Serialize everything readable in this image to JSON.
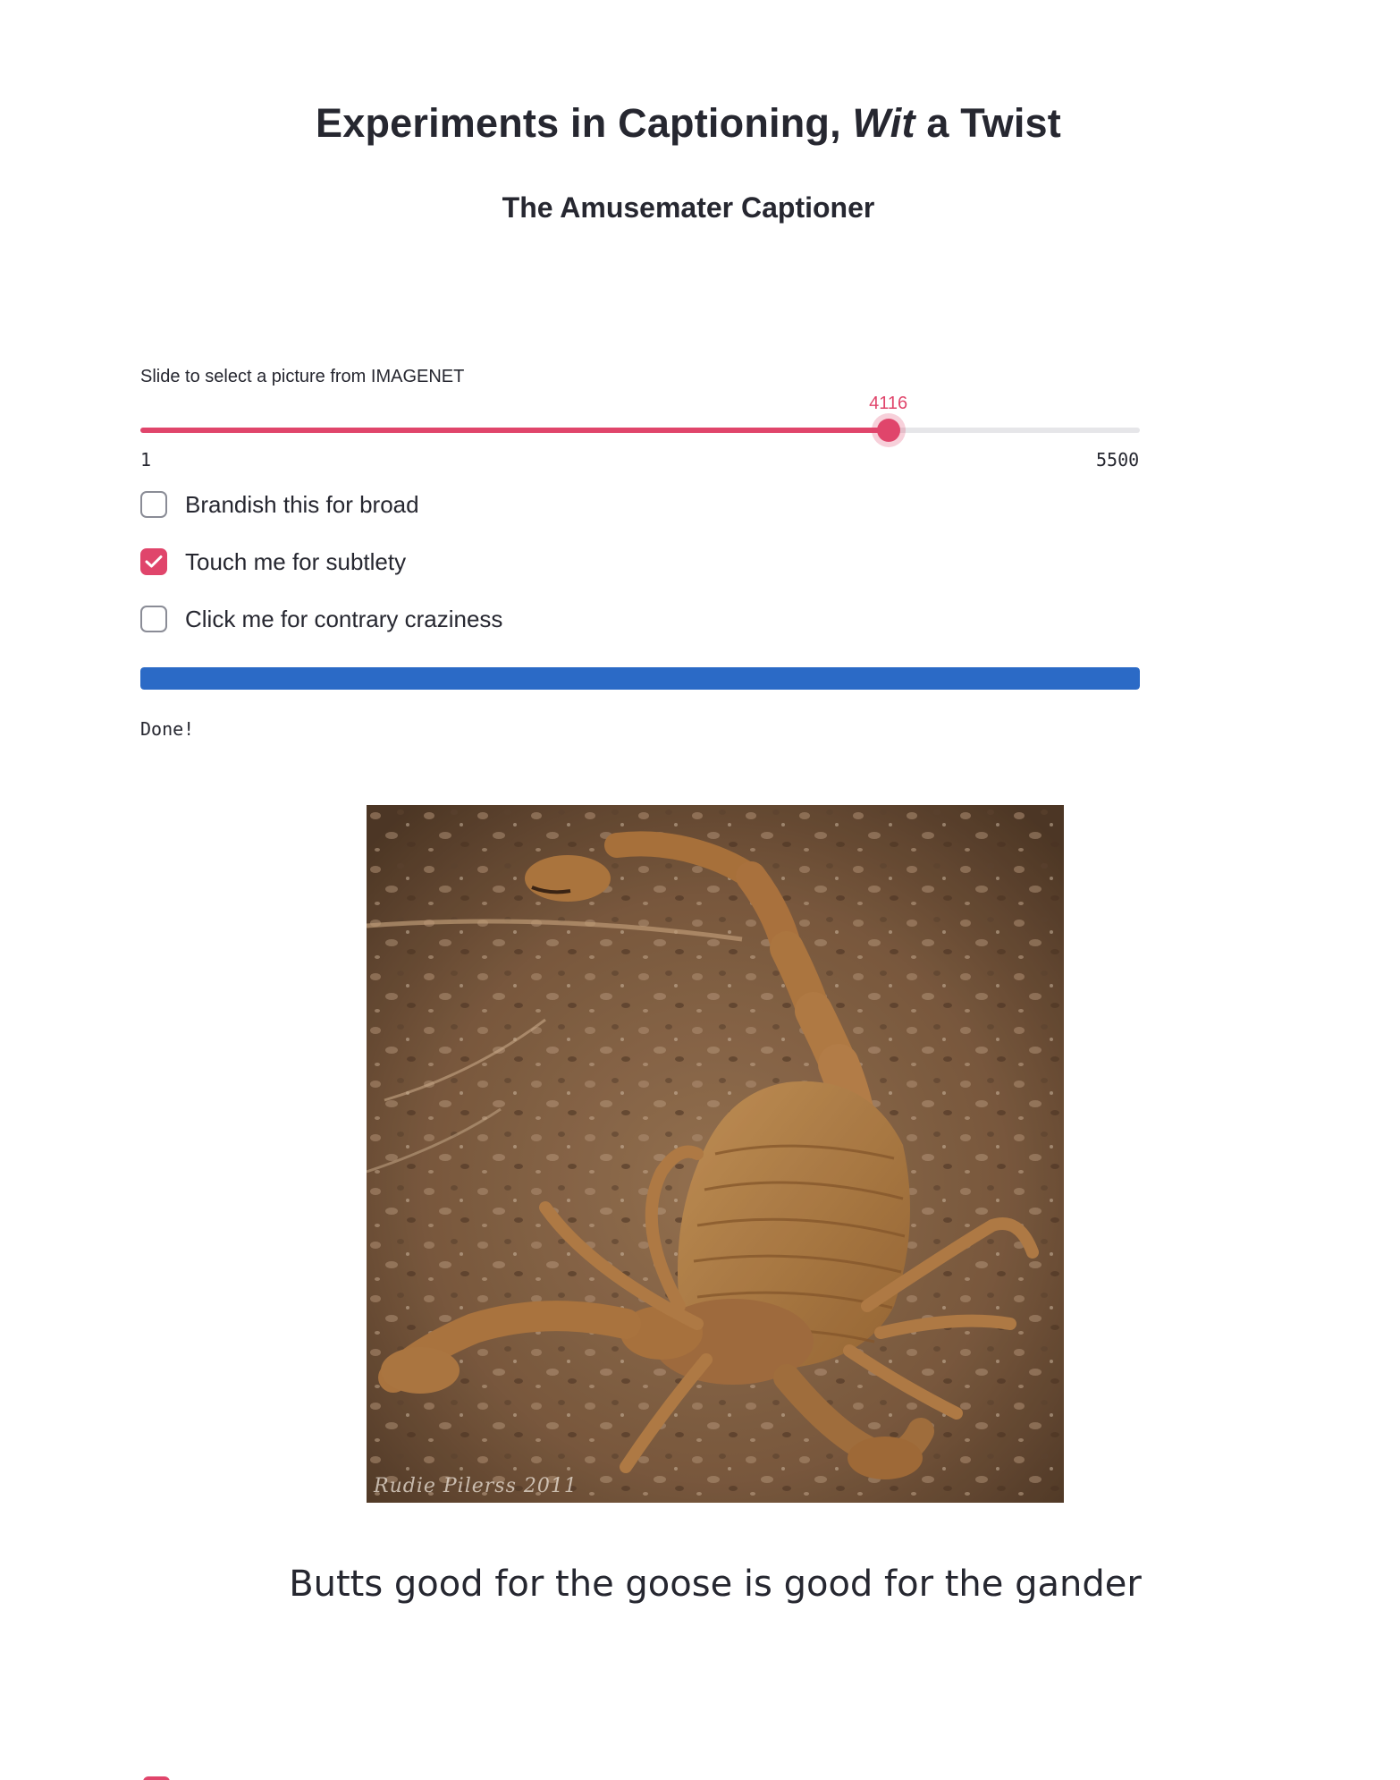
{
  "header": {
    "title_prefix": "Experiments in Captioning, ",
    "title_emphasis": "Wit",
    "title_suffix": " a Twist",
    "subtitle": "The Amusemater Captioner"
  },
  "slider": {
    "label": "Slide to select a picture from IMAGENET",
    "value": 4116,
    "value_label": "4116",
    "min": 1,
    "min_label": "1",
    "max": 5500,
    "max_label": "5500",
    "accent_color": "#e0456b"
  },
  "checkboxes": [
    {
      "label": "Brandish this for broad",
      "checked": false
    },
    {
      "label": "Touch me for subtlety",
      "checked": true
    },
    {
      "label": "Click me for contrary craziness",
      "checked": false
    }
  ],
  "progress": {
    "value_percent": 100,
    "color": "#2b6ac6",
    "status_text": "Done!"
  },
  "photo": {
    "subject": "scorpion on gravel",
    "watermark": "Rudie Pilerss 2011"
  },
  "caption": "Butts good for the goose is good for the gander"
}
